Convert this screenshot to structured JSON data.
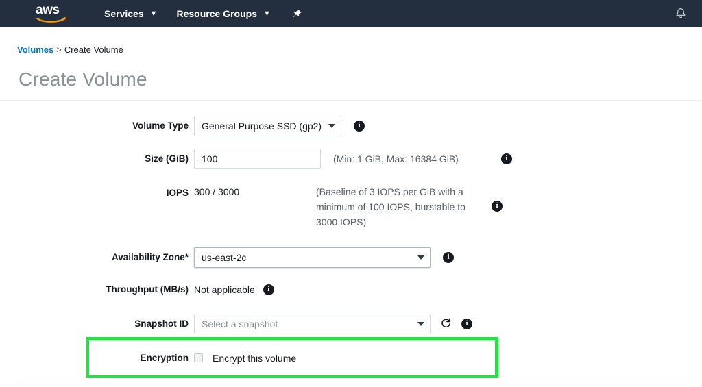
{
  "navbar": {
    "logo_text": "aws",
    "logo_alt": "aws-logo",
    "services_label": "Services",
    "resource_groups_label": "Resource Groups",
    "caret_glyph": "▼",
    "pin_icon": "pin-icon",
    "bell_icon": "bell-icon",
    "background_color": "#232f3e",
    "logo_accent_color": "#ff9900"
  },
  "breadcrumb": {
    "parent": "Volumes",
    "separator": ">",
    "current": "Create Volume"
  },
  "header": {
    "title": "Create Volume"
  },
  "form": {
    "volume_type": {
      "label": "Volume Type",
      "value": "General Purpose SSD (gp2)",
      "info": "i"
    },
    "size": {
      "label": "Size (GiB)",
      "value": "100",
      "placeholder": "",
      "hint": "(Min: 1 GiB, Max: 16384 GiB)",
      "info": "i"
    },
    "iops": {
      "label": "IOPS",
      "value": "300 / 3000",
      "hint": "(Baseline of 3 IOPS per GiB with a minimum of 100 IOPS, burstable to 3000 IOPS)",
      "info": "i"
    },
    "availability_zone": {
      "label": "Availability Zone*",
      "value": "us-east-2c",
      "info": "i",
      "highlight_color": "#2ddb4a"
    },
    "throughput": {
      "label": "Throughput (MB/s)",
      "value": "Not applicable",
      "info": "i"
    },
    "snapshot_id": {
      "label": "Snapshot ID",
      "placeholder": "Select a snapshot",
      "refresh_icon": "refresh-icon",
      "info": "i"
    },
    "encryption": {
      "label": "Encryption",
      "checkbox_label": "Encrypt this volume",
      "checked": false
    }
  }
}
